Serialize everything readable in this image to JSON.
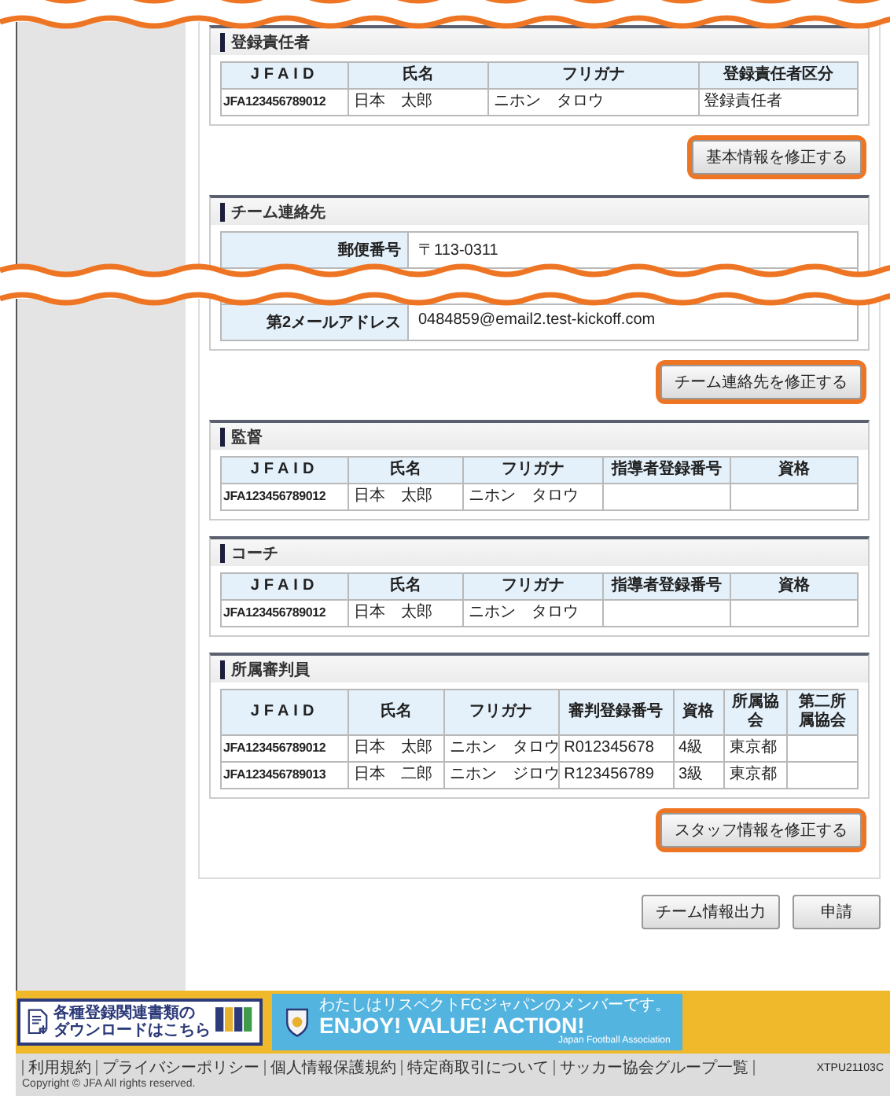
{
  "sections": [
    {
      "kind": "table",
      "title": "登録責任者",
      "columns": [
        "JFAID",
        "氏名",
        "フリガナ",
        "登録責任者区分"
      ],
      "rows": [
        [
          "JFA123456789012",
          "日本　太郎",
          "ニホン　タロウ",
          "登録責任者"
        ]
      ],
      "button": {
        "label": "基本情報を修正する",
        "highlighted": true
      }
    },
    {
      "kind": "form",
      "title": "チーム連絡先",
      "fields": [
        {
          "label": "郵便番号",
          "value": "〒113-0311"
        },
        {
          "label": "第2メールアドレス",
          "value": "0484859@email2.test-kickoff.com"
        }
      ],
      "button": {
        "label": "チーム連絡先を修正する",
        "highlighted": true
      }
    },
    {
      "kind": "table",
      "title": "監督",
      "columns": [
        "JFAID",
        "氏名",
        "フリガナ",
        "指導者登録番号",
        "資格"
      ],
      "rows": [
        [
          "JFA123456789012",
          "日本　太郎",
          "ニホン　タロウ",
          "",
          ""
        ]
      ]
    },
    {
      "kind": "table",
      "title": "コーチ",
      "columns": [
        "JFAID",
        "氏名",
        "フリガナ",
        "指導者登録番号",
        "資格"
      ],
      "rows": [
        [
          "JFA123456789012",
          "日本　太郎",
          "ニホン　タロウ",
          "",
          ""
        ]
      ]
    },
    {
      "kind": "table",
      "title": "所属審判員",
      "columns": [
        "JFAID",
        "氏名",
        "フリガナ",
        "審判登録番号",
        "資格",
        "所属協会",
        "第二所属協会"
      ],
      "rows": [
        [
          "JFA123456789012",
          "日本　太郎",
          "ニホン　タロウ",
          "R012345678",
          "4級",
          "東京都",
          ""
        ],
        [
          "JFA123456789013",
          "日本　二郎",
          "ニホン　ジロウ",
          "R123456789",
          "3級",
          "東京都",
          ""
        ]
      ],
      "button": {
        "label": "スタッフ情報を修正する",
        "highlighted": true
      }
    }
  ],
  "actions": [
    "チーム情報出力",
    "申請"
  ],
  "banners": {
    "download": [
      "各種登録関連書類の",
      "ダウンロードはこちら"
    ],
    "respect": {
      "tagline": "わたしはリスペクトFCジャパンのメンバーです。",
      "slogan": "ENJOY! VALUE! ACTION!",
      "org": "Japan Football Association"
    }
  },
  "footer": {
    "links": [
      "利用規約",
      "プライバシーポリシー",
      "個人情報保護規約",
      "特定商取引について",
      "サッカー協会グループ一覧"
    ],
    "screen_code": "XTPU21103C",
    "copyright": "Copyright © JFA All rights reserved."
  }
}
